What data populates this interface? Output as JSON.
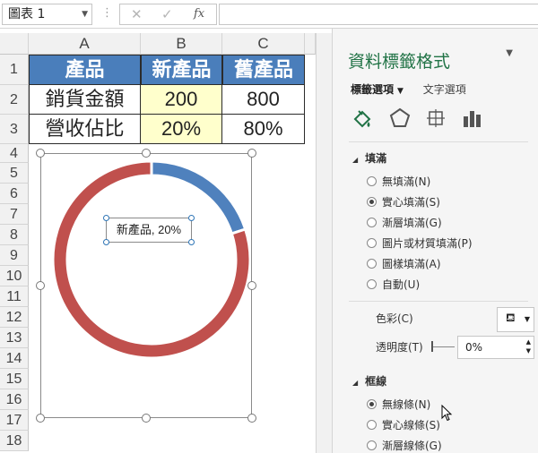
{
  "formula_bar": {
    "name_box": "圖表 1",
    "cancel_glyph": "✕",
    "enter_glyph": "✓",
    "fx_glyph": "fx",
    "formula": ""
  },
  "sheet": {
    "columns": [
      "A",
      "B",
      "C"
    ],
    "rows": [
      "1",
      "2",
      "3",
      "4",
      "5",
      "6",
      "7",
      "8",
      "9",
      "10",
      "11",
      "12",
      "13",
      "14",
      "15",
      "16",
      "17",
      "18"
    ],
    "table": {
      "headers": [
        "產品",
        "新產品",
        "舊產品"
      ],
      "row1": [
        "銷貨金額",
        "200",
        "800"
      ],
      "row2": [
        "營收佔比",
        "20%",
        "80%"
      ]
    }
  },
  "chart": {
    "data_label": "新產品, 20%"
  },
  "chart_data": {
    "type": "pie",
    "categories": [
      "新產品",
      "舊產品"
    ],
    "values": [
      20,
      80
    ],
    "colors": [
      "#4f81bd",
      "#c0504d"
    ]
  },
  "pane": {
    "title": "資料標籤格式",
    "tab_label_options": "標籤選項",
    "tab_text_options": "文字選項",
    "fill_section": "填滿",
    "fill_options": [
      "無填滿(N)",
      "實心填滿(S)",
      "漸層填滿(G)",
      "圖片或材質填滿(P)",
      "圖樣填滿(A)",
      "自動(U)"
    ],
    "fill_selected_index": 1,
    "color_label": "色彩(C)",
    "transparency_label": "透明度(T)",
    "transparency_value": "0%",
    "border_section": "框線",
    "border_options": [
      "無線條(N)",
      "實心線條(S)",
      "漸層線條(G)"
    ],
    "border_selected_index": 0
  }
}
